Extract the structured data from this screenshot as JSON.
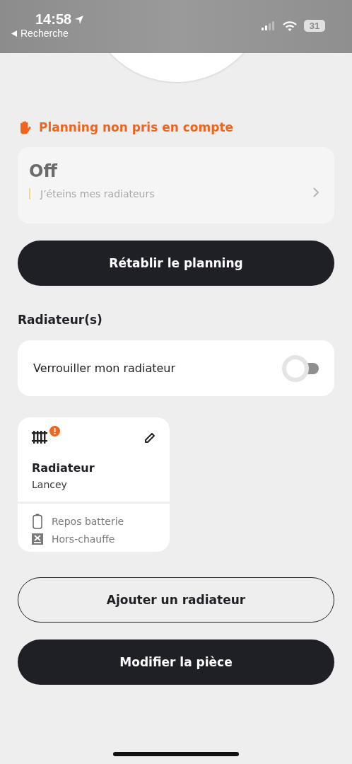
{
  "status_bar": {
    "time": "14:58",
    "back_label": "Recherche",
    "battery": "31"
  },
  "warning": {
    "text": "Planning non pris en compte"
  },
  "mode_card": {
    "title": "Off",
    "subtitle": "J’éteins mes radiateurs"
  },
  "restore_button": {
    "label": "Rétablir le planning"
  },
  "section_title": "Radiateur(s)",
  "lock_row": {
    "label": "Verrouiller mon radiateur",
    "on": false
  },
  "radiators": [
    {
      "name": "Radiateur",
      "brand": "Lancey",
      "alert": true,
      "statuses": [
        {
          "kind": "battery",
          "label": "Repos batterie"
        },
        {
          "kind": "offheat",
          "label": "Hors-chauffe"
        }
      ]
    }
  ],
  "buttons": [
    {
      "kind": "outline",
      "label": "Ajouter un radiateur"
    },
    {
      "kind": "filled",
      "label": "Modifier la pièce"
    }
  ]
}
